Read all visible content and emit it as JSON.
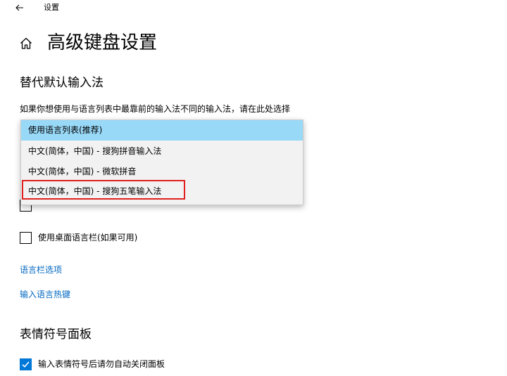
{
  "window": {
    "title": "设置"
  },
  "header": {
    "title": "高级键盘设置"
  },
  "override_section": {
    "heading": "替代默认输入法",
    "description": "如果你想使用与语言列表中最靠前的输入法不同的输入法，请在此处选择",
    "dropdown": {
      "options": [
        "使用语言列表(推荐)",
        "中文(简体，中国) - 搜狗拼音输入法",
        "中文(简体，中国) - 微软拼音",
        "中文(简体，中国) - 搜狗五笔输入法"
      ],
      "selected_index": 0,
      "highlighted_index": 3
    }
  },
  "language_bar": {
    "desktop_bar_label": "使用桌面语言栏(如果可用)",
    "desktop_bar_checked": false,
    "options_link": "语言栏选项",
    "hotkeys_link": "输入语言热键"
  },
  "emoji_section": {
    "heading": "表情符号面板",
    "auto_close_label": "输入表情符号后请勿自动关闭面板",
    "auto_close_checked": true
  },
  "colors": {
    "accent": "#0078d7",
    "link": "#0067c0",
    "selected_option": "#99d9f8",
    "highlight_box": "#e0201e"
  },
  "icons": {
    "back": "arrow-left-icon",
    "home": "home-icon",
    "check": "checkmark-icon"
  }
}
